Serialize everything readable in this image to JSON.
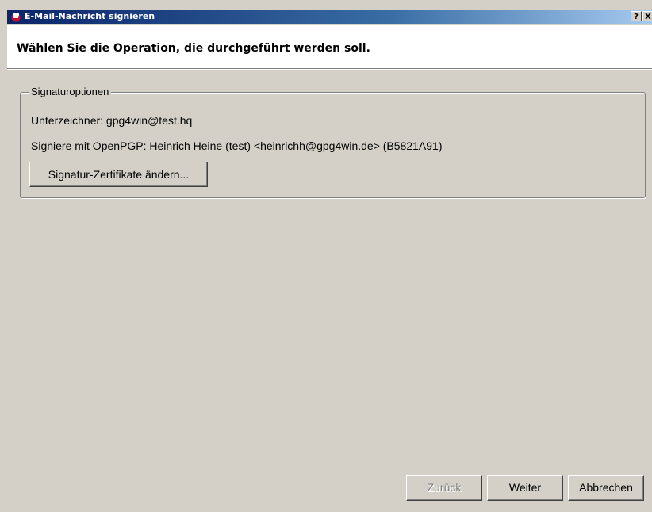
{
  "window": {
    "title": "E-Mail-Nachricht signieren",
    "help_label": "?",
    "close_label": "X"
  },
  "header": {
    "title": "Wählen Sie die Operation, die durchgeführt werden soll."
  },
  "signature_options": {
    "legend": "Signaturoptionen",
    "signer": "Unterzeichner:  gpg4win@test.hq",
    "sign_with": "Signiere mit OpenPGP: Heinrich Heine (test) <heinrichh@gpg4win.de> (B5821A91)",
    "change_button": "Signatur-Zertifikate ändern..."
  },
  "footer": {
    "back_label": "Zurück",
    "back_enabled": false,
    "next_label": "Weiter",
    "cancel_label": "Abbrechen"
  },
  "colors": {
    "titlebar_start": "#0a246a",
    "titlebar_end": "#a6caf0",
    "dialog_bg": "#d4d0c8",
    "header_bg": "#ffffff"
  },
  "icons": {
    "app_icon": "gpg4win-app-icon"
  }
}
